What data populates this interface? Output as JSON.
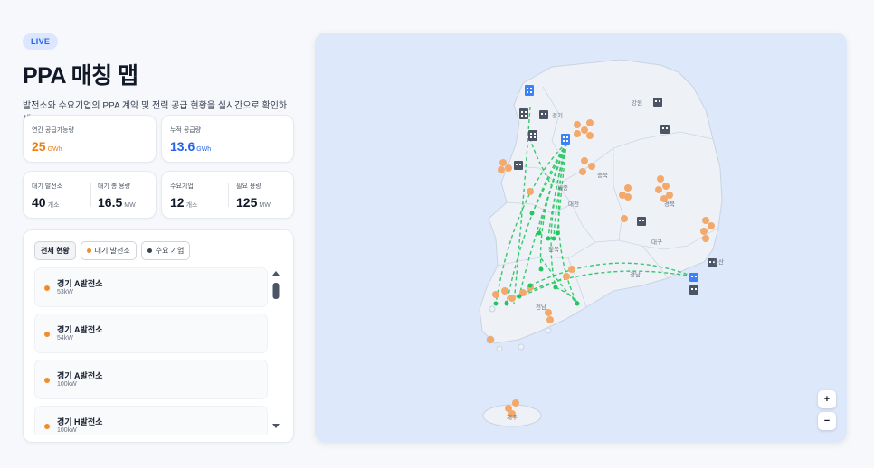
{
  "header": {
    "badge": "LIVE",
    "title": "PPA 매칭 맵",
    "subtitle": "발전소와 수요기업의 PPA 계약 및 전력 공급 현황을 실시간으로 확인하세요."
  },
  "stats": {
    "annual_supply": {
      "label": "연간 공급가능량",
      "value": "25",
      "unit": "GWh"
    },
    "cumulative_supply": {
      "label": "누적 공급량",
      "value": "13.6",
      "unit": "GWh"
    },
    "waiting_plants": {
      "label": "대기 발전소",
      "value": "40",
      "unit": "개소"
    },
    "waiting_capacity": {
      "label": "대기 총 용량",
      "value": "16.5",
      "unit": "MW"
    },
    "demand_companies": {
      "label": "수요기업",
      "value": "12",
      "unit": "개소"
    },
    "required_capacity": {
      "label": "필요 용량",
      "value": "125",
      "unit": "MW"
    }
  },
  "filters": [
    {
      "label": "전체 현황",
      "active": true
    },
    {
      "label": "대기 발전소",
      "dot_color": "#f28c28"
    },
    {
      "label": "수요 기업",
      "dot_color": "#374151"
    }
  ],
  "plants": [
    {
      "name": "경기 A발전소",
      "capacity": "53kW"
    },
    {
      "name": "경기 A발전소",
      "capacity": "54kW"
    },
    {
      "name": "경기 A발전소",
      "capacity": "100kW"
    },
    {
      "name": "경기 H발전소",
      "capacity": "100kW"
    }
  ],
  "map": {
    "labels": {
      "gangwon": "강원",
      "gyeonggi": "경기",
      "chungbuk": "충북",
      "sejong": "세종",
      "daejeon": "대전",
      "gyeongbuk": "경북",
      "daegu": "대구",
      "jeonbuk": "전북",
      "gyeongnam": "경남",
      "ulsan": "울산",
      "jeonnam": "전남",
      "jeju": "제주"
    },
    "zoom_in": "+",
    "zoom_out": "−",
    "colors": {
      "plant": "#f28c28",
      "demand": "#4b5563",
      "demand_active": "#3b82f6",
      "flow": "#22c55e"
    }
  }
}
